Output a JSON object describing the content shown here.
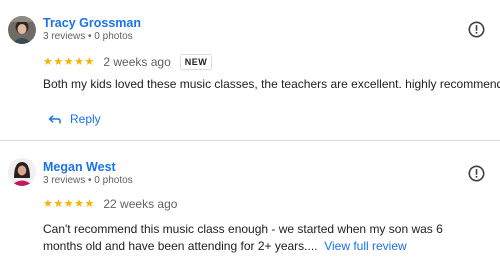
{
  "reviews": [
    {
      "author": "Tracy Grossman",
      "meta": "3 reviews • 0 photos",
      "rating": 5,
      "date": "2 weeks ago",
      "badge": "NEW",
      "text": "Both my kids loved these music classes, the teachers are excellent. highly recommend!",
      "reply_label": "Reply"
    },
    {
      "author": "Megan West",
      "meta": "3 reviews • 0 photos",
      "rating": 5,
      "date": "22 weeks ago",
      "text": "Can't recommend this music class enough - we started when my son was 6 months old and have been attending for 2+ years....",
      "more_link": "View full review"
    }
  ],
  "icons": {
    "more": "exclamation-circle-icon",
    "reply": "reply-arrow-icon",
    "star": "star-icon"
  },
  "colors": {
    "accent": "#1a73e8",
    "star": "#f5b400",
    "muted": "#5f6368",
    "divider": "#dadce0"
  }
}
